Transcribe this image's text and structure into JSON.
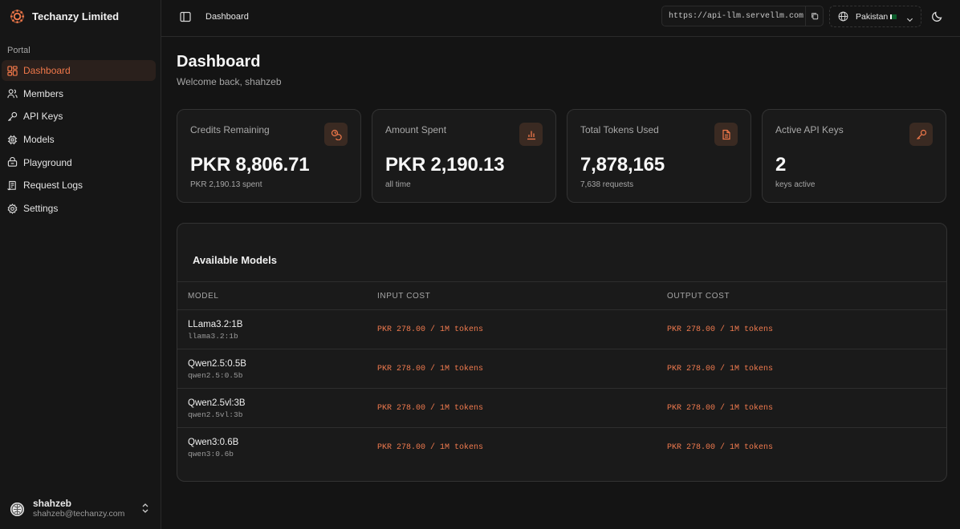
{
  "brand": {
    "name": "Techanzy Limited",
    "accent": "#f0784a"
  },
  "sidebar": {
    "section_label": "Portal",
    "items": [
      {
        "label": "Dashboard",
        "icon": "grid-icon",
        "active": true
      },
      {
        "label": "Members",
        "icon": "users-icon",
        "active": false
      },
      {
        "label": "API Keys",
        "icon": "key-icon",
        "active": false
      },
      {
        "label": "Models",
        "icon": "chip-icon",
        "active": false
      },
      {
        "label": "Playground",
        "icon": "playground-icon",
        "active": false
      },
      {
        "label": "Request Logs",
        "icon": "logs-icon",
        "active": false
      },
      {
        "label": "Settings",
        "icon": "gear-icon",
        "active": false
      }
    ],
    "user": {
      "name": "shahzeb",
      "email": "shahzeb@techanzy.com"
    }
  },
  "topbar": {
    "breadcrumb": "Dashboard",
    "api_url": "https://api-llm.servellm.com",
    "region": "Pakistan"
  },
  "page": {
    "title": "Dashboard",
    "subtitle": "Welcome back, shahzeb"
  },
  "stats": [
    {
      "title": "Credits Remaining",
      "value": "PKR 8,806.71",
      "sub": "PKR 2,190.13 spent",
      "icon": "coins-icon"
    },
    {
      "title": "Amount Spent",
      "value": "PKR 2,190.13",
      "sub": "all time",
      "icon": "bar-chart-icon"
    },
    {
      "title": "Total Tokens Used",
      "value": "7,878,165",
      "sub": "7,638 requests",
      "icon": "document-icon"
    },
    {
      "title": "Active API Keys",
      "value": "2",
      "sub": "keys active",
      "icon": "key-icon"
    }
  ],
  "models": {
    "title": "Available Models",
    "columns": [
      "MODEL",
      "INPUT COST",
      "OUTPUT COST"
    ],
    "rows": [
      {
        "name": "LLama3.2:1B",
        "id": "llama3.2:1b",
        "input": "PKR 278.00 / 1M tokens",
        "output": "PKR 278.00 / 1M tokens"
      },
      {
        "name": "Qwen2.5:0.5B",
        "id": "qwen2.5:0.5b",
        "input": "PKR 278.00 / 1M tokens",
        "output": "PKR 278.00 / 1M tokens"
      },
      {
        "name": "Qwen2.5vl:3B",
        "id": "qwen2.5vl:3b",
        "input": "PKR 278.00 / 1M tokens",
        "output": "PKR 278.00 / 1M tokens"
      },
      {
        "name": "Qwen3:0.6B",
        "id": "qwen3:0.6b",
        "input": "PKR 278.00 / 1M tokens",
        "output": "PKR 278.00 / 1M tokens"
      }
    ]
  }
}
